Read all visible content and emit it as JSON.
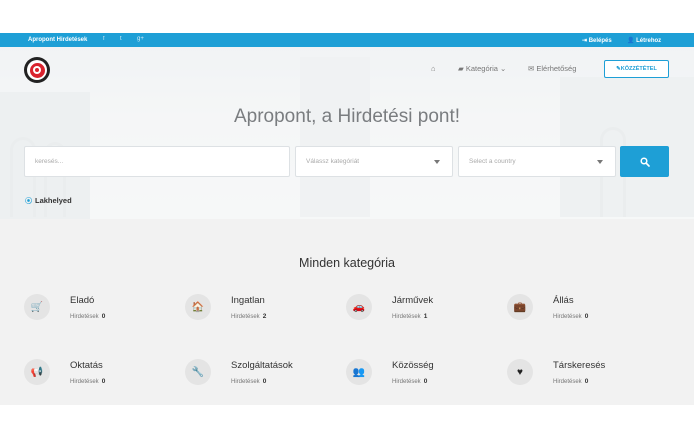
{
  "topbar": {
    "brand": "Apropont Hirdetések",
    "social": [
      "f",
      "t",
      "g+"
    ],
    "login": "Belépés",
    "register": "Létrehoz"
  },
  "nav": {
    "home_icon": "home-icon",
    "category": "Kategória",
    "contact": "Elérhetőség",
    "post_button": "KÖZZÉTÉTEL"
  },
  "hero": {
    "title": "Apropont, a Hirdetési pont!"
  },
  "search": {
    "placeholder": "keresés...",
    "category_select": "Válassz kategóriát",
    "country_select": "Select a country"
  },
  "location": {
    "label": "Lakhelyed"
  },
  "categories": {
    "heading": "Minden kategória",
    "count_label": "Hirdetések",
    "items": [
      {
        "name": "Eladó",
        "count": "0",
        "icon": "cart-icon",
        "glyph": "🛒"
      },
      {
        "name": "Ingatlan",
        "count": "2",
        "icon": "home-icon",
        "glyph": "🏠"
      },
      {
        "name": "Járművek",
        "count": "1",
        "icon": "car-icon",
        "glyph": "🚗"
      },
      {
        "name": "Állás",
        "count": "0",
        "icon": "briefcase-icon",
        "glyph": "💼"
      },
      {
        "name": "Oktatás",
        "count": "0",
        "icon": "megaphone-icon",
        "glyph": "📢"
      },
      {
        "name": "Szolgáltatások",
        "count": "0",
        "icon": "wrench-icon",
        "glyph": "🔧"
      },
      {
        "name": "Közösség",
        "count": "0",
        "icon": "users-icon",
        "glyph": "👥"
      },
      {
        "name": "Társkeresés",
        "count": "0",
        "icon": "heart-icon",
        "glyph": "♥"
      }
    ]
  },
  "colors": {
    "accent": "#1e9fd6",
    "logo_red": "#d9232e"
  }
}
